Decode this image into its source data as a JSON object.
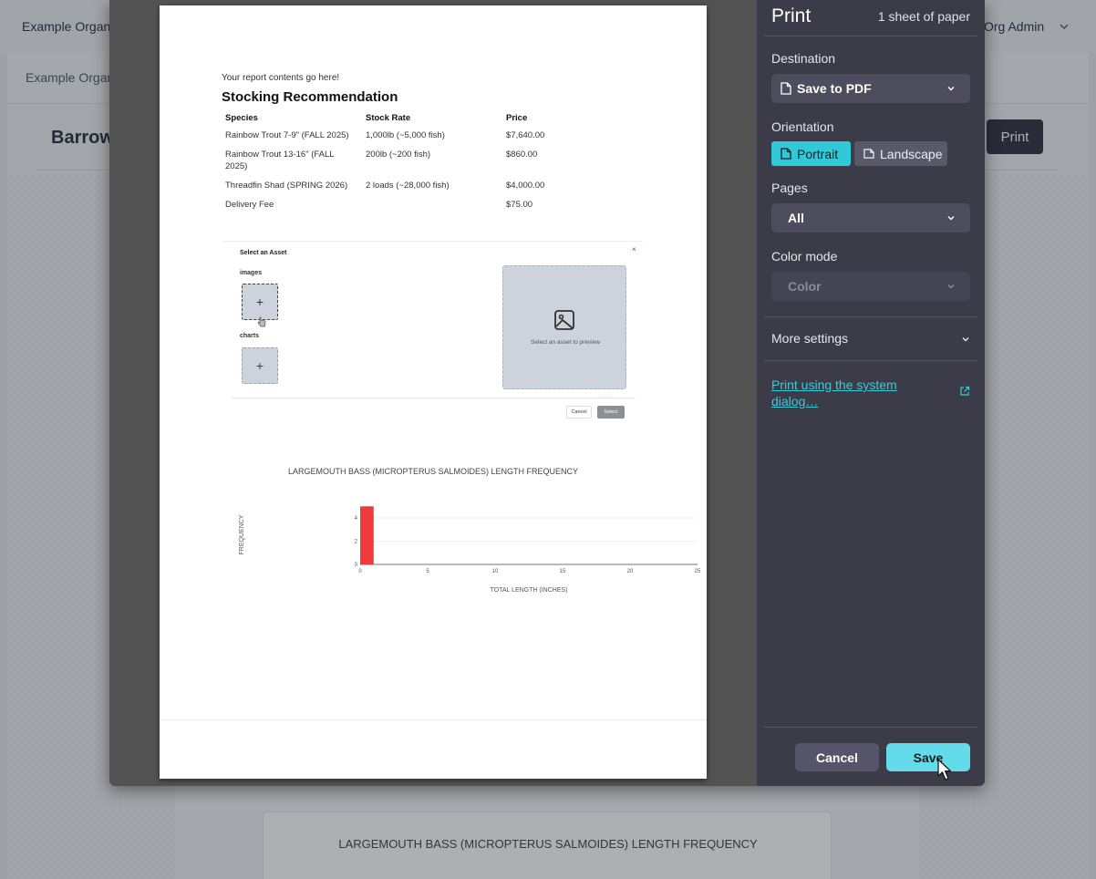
{
  "app": {
    "org_name": "Example Organ",
    "user_menu": "Org Admin",
    "breadcrumb": "Example Organ",
    "page_title": "Barrow",
    "print_button": "Print",
    "bg_chart_title": "LARGEMOUTH BASS (MICROPTERUS SALMOIDES) LENGTH FREQUENCY"
  },
  "report": {
    "intro": "Your report contents go here!",
    "heading": "Stocking Recommendation",
    "table": {
      "headers": [
        "Species",
        "Stock Rate",
        "Price"
      ],
      "rows": [
        [
          "Rainbow Trout 7-9\" (FALL 2025)",
          "1,000lb (~5,000 fish)",
          "$7,640.00"
        ],
        [
          "Rainbow Trout 13-16\" (FALL 2025)",
          "200lb (~200 fish)",
          "$860.00"
        ],
        [
          "Threadfin Shad (SPRING 2026)",
          "2 loads (~28,000 fish)",
          "$4,000.00"
        ],
        [
          "Delivery Fee",
          "",
          "$75.00"
        ]
      ]
    },
    "asset_modal": {
      "title": "Select an Asset",
      "close": "×",
      "images_label": "images",
      "charts_label": "charts",
      "add_symbol": "+",
      "preview_text": "Select an asset to preview",
      "cancel": "Cancel",
      "select": "Select"
    }
  },
  "chart_data": {
    "type": "bar",
    "title": "LARGEMOUTH BASS (MICROPTERUS SALMOIDES) LENGTH FREQUENCY",
    "xlabel": "TOTAL LENGTH (INCHES)",
    "ylabel": "FREQUENCY",
    "x": [
      0.5
    ],
    "values": [
      5
    ],
    "bar_width": 1,
    "xlim": [
      0,
      25
    ],
    "ylim": [
      0,
      5.1
    ],
    "xticks": [
      0,
      5,
      10,
      15,
      20,
      25
    ],
    "yticks": [
      0,
      2,
      4
    ],
    "bar_color": "#ef3b3b",
    "grid": true
  },
  "print": {
    "title": "Print",
    "sheets": "1 sheet of paper",
    "destination_label": "Destination",
    "destination_value": "Save to PDF",
    "orientation_label": "Orientation",
    "portrait": "Portrait",
    "landscape": "Landscape",
    "pages_label": "Pages",
    "pages_value": "All",
    "color_label": "Color mode",
    "color_value": "Color",
    "more_settings": "More settings",
    "system_dialog": "Print using the system dialog…",
    "cancel": "Cancel",
    "save": "Save",
    "accent_color": "#31c8d8"
  }
}
